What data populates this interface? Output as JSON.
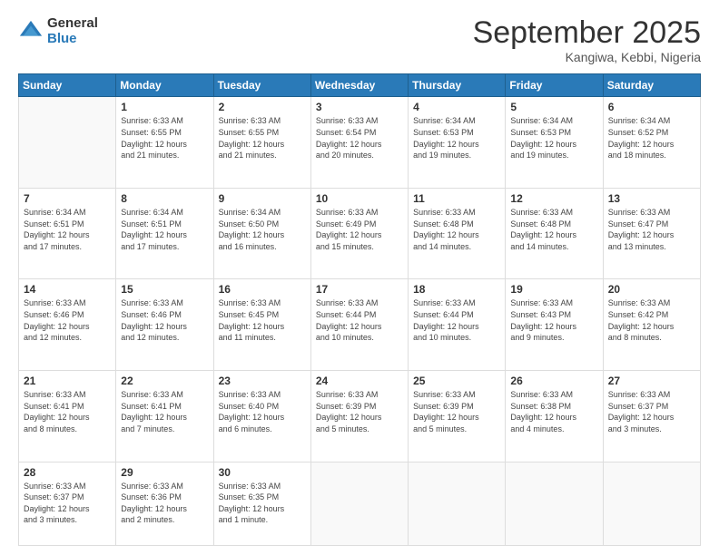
{
  "logo": {
    "general": "General",
    "blue": "Blue"
  },
  "header": {
    "month": "September 2025",
    "location": "Kangiwa, Kebbi, Nigeria"
  },
  "days": [
    "Sunday",
    "Monday",
    "Tuesday",
    "Wednesday",
    "Thursday",
    "Friday",
    "Saturday"
  ],
  "weeks": [
    [
      {
        "day": "",
        "content": ""
      },
      {
        "day": "1",
        "content": "Sunrise: 6:33 AM\nSunset: 6:55 PM\nDaylight: 12 hours\nand 21 minutes."
      },
      {
        "day": "2",
        "content": "Sunrise: 6:33 AM\nSunset: 6:55 PM\nDaylight: 12 hours\nand 21 minutes."
      },
      {
        "day": "3",
        "content": "Sunrise: 6:33 AM\nSunset: 6:54 PM\nDaylight: 12 hours\nand 20 minutes."
      },
      {
        "day": "4",
        "content": "Sunrise: 6:34 AM\nSunset: 6:53 PM\nDaylight: 12 hours\nand 19 minutes."
      },
      {
        "day": "5",
        "content": "Sunrise: 6:34 AM\nSunset: 6:53 PM\nDaylight: 12 hours\nand 19 minutes."
      },
      {
        "day": "6",
        "content": "Sunrise: 6:34 AM\nSunset: 6:52 PM\nDaylight: 12 hours\nand 18 minutes."
      }
    ],
    [
      {
        "day": "7",
        "content": "Sunrise: 6:34 AM\nSunset: 6:51 PM\nDaylight: 12 hours\nand 17 minutes."
      },
      {
        "day": "8",
        "content": "Sunrise: 6:34 AM\nSunset: 6:51 PM\nDaylight: 12 hours\nand 17 minutes."
      },
      {
        "day": "9",
        "content": "Sunrise: 6:34 AM\nSunset: 6:50 PM\nDaylight: 12 hours\nand 16 minutes."
      },
      {
        "day": "10",
        "content": "Sunrise: 6:33 AM\nSunset: 6:49 PM\nDaylight: 12 hours\nand 15 minutes."
      },
      {
        "day": "11",
        "content": "Sunrise: 6:33 AM\nSunset: 6:48 PM\nDaylight: 12 hours\nand 14 minutes."
      },
      {
        "day": "12",
        "content": "Sunrise: 6:33 AM\nSunset: 6:48 PM\nDaylight: 12 hours\nand 14 minutes."
      },
      {
        "day": "13",
        "content": "Sunrise: 6:33 AM\nSunset: 6:47 PM\nDaylight: 12 hours\nand 13 minutes."
      }
    ],
    [
      {
        "day": "14",
        "content": "Sunrise: 6:33 AM\nSunset: 6:46 PM\nDaylight: 12 hours\nand 12 minutes."
      },
      {
        "day": "15",
        "content": "Sunrise: 6:33 AM\nSunset: 6:46 PM\nDaylight: 12 hours\nand 12 minutes."
      },
      {
        "day": "16",
        "content": "Sunrise: 6:33 AM\nSunset: 6:45 PM\nDaylight: 12 hours\nand 11 minutes."
      },
      {
        "day": "17",
        "content": "Sunrise: 6:33 AM\nSunset: 6:44 PM\nDaylight: 12 hours\nand 10 minutes."
      },
      {
        "day": "18",
        "content": "Sunrise: 6:33 AM\nSunset: 6:44 PM\nDaylight: 12 hours\nand 10 minutes."
      },
      {
        "day": "19",
        "content": "Sunrise: 6:33 AM\nSunset: 6:43 PM\nDaylight: 12 hours\nand 9 minutes."
      },
      {
        "day": "20",
        "content": "Sunrise: 6:33 AM\nSunset: 6:42 PM\nDaylight: 12 hours\nand 8 minutes."
      }
    ],
    [
      {
        "day": "21",
        "content": "Sunrise: 6:33 AM\nSunset: 6:41 PM\nDaylight: 12 hours\nand 8 minutes."
      },
      {
        "day": "22",
        "content": "Sunrise: 6:33 AM\nSunset: 6:41 PM\nDaylight: 12 hours\nand 7 minutes."
      },
      {
        "day": "23",
        "content": "Sunrise: 6:33 AM\nSunset: 6:40 PM\nDaylight: 12 hours\nand 6 minutes."
      },
      {
        "day": "24",
        "content": "Sunrise: 6:33 AM\nSunset: 6:39 PM\nDaylight: 12 hours\nand 5 minutes."
      },
      {
        "day": "25",
        "content": "Sunrise: 6:33 AM\nSunset: 6:39 PM\nDaylight: 12 hours\nand 5 minutes."
      },
      {
        "day": "26",
        "content": "Sunrise: 6:33 AM\nSunset: 6:38 PM\nDaylight: 12 hours\nand 4 minutes."
      },
      {
        "day": "27",
        "content": "Sunrise: 6:33 AM\nSunset: 6:37 PM\nDaylight: 12 hours\nand 3 minutes."
      }
    ],
    [
      {
        "day": "28",
        "content": "Sunrise: 6:33 AM\nSunset: 6:37 PM\nDaylight: 12 hours\nand 3 minutes."
      },
      {
        "day": "29",
        "content": "Sunrise: 6:33 AM\nSunset: 6:36 PM\nDaylight: 12 hours\nand 2 minutes."
      },
      {
        "day": "30",
        "content": "Sunrise: 6:33 AM\nSunset: 6:35 PM\nDaylight: 12 hours\nand 1 minute."
      },
      {
        "day": "",
        "content": ""
      },
      {
        "day": "",
        "content": ""
      },
      {
        "day": "",
        "content": ""
      },
      {
        "day": "",
        "content": ""
      }
    ]
  ]
}
